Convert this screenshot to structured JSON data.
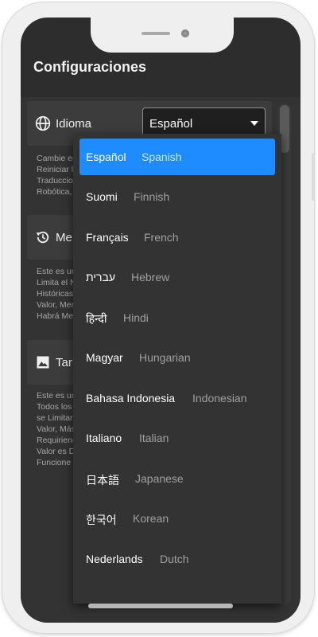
{
  "header": {
    "title": "Configuraciones"
  },
  "settings": [
    {
      "id": "language",
      "label": "Idioma",
      "icon": "globe-icon",
      "description": "Cambie es\nReiniciar l\nTraduccio\nRobótica,"
    },
    {
      "id": "memory",
      "label": "Me",
      "icon": "history-icon",
      "description": "Este es ur\nLimita el N\nHistóricas\nValor, Mer\nHabrá Me"
    },
    {
      "id": "image-size",
      "label": "Tar",
      "icon": "image-icon",
      "description": "Este es ur\nTodos los\nse Limitar\nValor, Más\nRequiriend\nValor es D\nFuncione"
    }
  ],
  "language_select": {
    "value": "Español"
  },
  "language_options": [
    {
      "native": "Español",
      "english": "Spanish",
      "selected": true
    },
    {
      "native": "Suomi",
      "english": "Finnish"
    },
    {
      "native": "Français",
      "english": "French"
    },
    {
      "native": "עברית",
      "english": "Hebrew"
    },
    {
      "native": "हिन्दी",
      "english": "Hindi"
    },
    {
      "native": "Magyar",
      "english": "Hungarian"
    },
    {
      "native": "Bahasa Indonesia",
      "english": "Indonesian"
    },
    {
      "native": "Italiano",
      "english": "Italian"
    },
    {
      "native": "日本語",
      "english": "Japanese"
    },
    {
      "native": "한국어",
      "english": "Korean"
    },
    {
      "native": "Nederlands",
      "english": "Dutch"
    }
  ],
  "colors": {
    "accent": "#1e8cff",
    "background": "#2d2d2d",
    "card": "#3c3c3c"
  }
}
